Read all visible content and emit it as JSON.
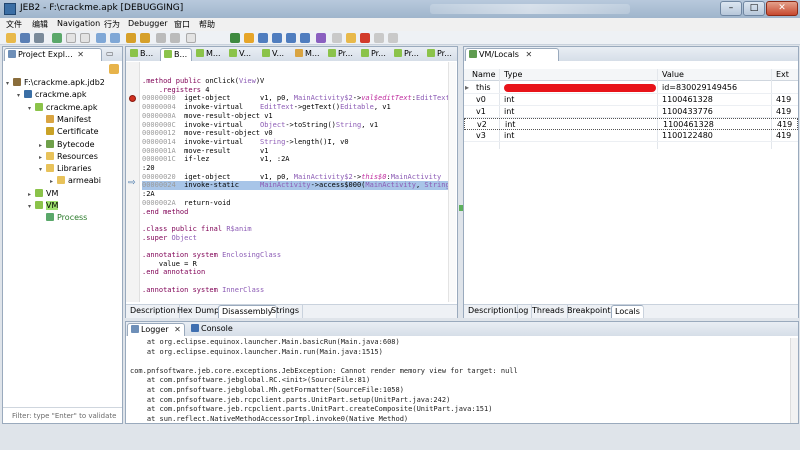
{
  "window": {
    "title": "JEB2 - F:\\crackme.apk [DEBUGGING]",
    "buttons": {
      "minimize": "–",
      "maximize": "□",
      "close": "✕"
    }
  },
  "menu": [
    "文件",
    "编辑",
    "Navigation",
    "行为",
    "Debugger",
    "窗口",
    "帮助"
  ],
  "toolbar_icons": [
    "open-icon",
    "save-icon",
    "settings-icon",
    "up-icon",
    "back-icon",
    "forward-icon",
    "run-icon",
    "debug-icon",
    "step-icon",
    "stop-icon",
    "pause-icon"
  ],
  "project_explorer": {
    "tab_label": "Project Expl...",
    "tree": [
      {
        "label": "F:\\crackme.apk.jdb2",
        "indent": 0,
        "arrow": "▾",
        "icon": "project"
      },
      {
        "label": "crackme.apk",
        "indent": 1,
        "arrow": "▾",
        "icon": "apk"
      },
      {
        "label": "crackme.apk",
        "indent": 2,
        "arrow": "▾",
        "icon": "android"
      },
      {
        "label": "Manifest",
        "indent": 3,
        "arrow": "",
        "icon": "manifest"
      },
      {
        "label": "Certificate",
        "indent": 3,
        "arrow": "",
        "icon": "certificate"
      },
      {
        "label": "Bytecode",
        "indent": 3,
        "arrow": "▸",
        "icon": "bytecode"
      },
      {
        "label": "Resources",
        "indent": 3,
        "arrow": "▸",
        "icon": "folder"
      },
      {
        "label": "Libraries",
        "indent": 3,
        "arrow": "▾",
        "icon": "folder"
      },
      {
        "label": "armeabi",
        "indent": 4,
        "arrow": "▸",
        "icon": "folder"
      },
      {
        "label": "VM",
        "indent": 2,
        "arrow": "▸",
        "icon": "android"
      },
      {
        "label": "VM",
        "indent": 2,
        "arrow": "▾",
        "icon": "android-highlight"
      },
      {
        "label": "Process",
        "indent": 3,
        "arrow": "",
        "icon": "process"
      }
    ],
    "filter_placeholder": "Filter: type \"Enter\" to validate"
  },
  "editor": {
    "tabs": [
      "B...",
      "B...",
      "M...",
      "V...",
      "V...",
      "M...",
      "Pr...",
      "Pr...",
      "Pr...",
      "Pr..."
    ],
    "bottom_tabs": [
      "Description",
      "Hex Dump",
      "Disassembly",
      "Strings"
    ],
    "active_bottom_tab": "Disassembly",
    "lines": [
      {
        "addr": "",
        "text": ".method public onClick(View)V",
        "kind": "header"
      },
      {
        "addr": "",
        "text": "    .registers 4",
        "kind": "directive"
      },
      {
        "addr": "00000000",
        "text": "iget-object       v1, p0, MainActivity$2->val$editText:EditText",
        "kind": "bp"
      },
      {
        "addr": "00000004",
        "text": "invoke-virtual    EditText->getText()Editable, v1",
        "kind": ""
      },
      {
        "addr": "0000000A",
        "text": "move-result-object v1",
        "kind": ""
      },
      {
        "addr": "0000000C",
        "text": "invoke-virtual    Object->toString()String, v1",
        "kind": ""
      },
      {
        "addr": "00000012",
        "text": "move-result-object v0",
        "kind": ""
      },
      {
        "addr": "00000014",
        "text": "invoke-virtual    String->length()I, v0",
        "kind": ""
      },
      {
        "addr": "0000001A",
        "text": "move-result       v1",
        "kind": ""
      },
      {
        "addr": "0000001C",
        "text": "if-lez            v1, :2A",
        "kind": ""
      },
      {
        "addr": "",
        "text": ":20",
        "kind": "label"
      },
      {
        "addr": "00000020",
        "text": "iget-object       v1, p0, MainActivity$2->this$0:MainActivity",
        "kind": ""
      },
      {
        "addr": "00000024",
        "text": "invoke-static     MainActivity->access$000(MainActivity, String)V",
        "kind": "current"
      },
      {
        "addr": "",
        "text": ":2A",
        "kind": "label"
      },
      {
        "addr": "0000002A",
        "text": "return-void",
        "kind": ""
      },
      {
        "addr": "",
        "text": ".end method",
        "kind": "header"
      },
      {
        "addr": "",
        "text": "",
        "kind": "blank"
      },
      {
        "addr": "",
        "text": ".class public final R$anim",
        "kind": "header"
      },
      {
        "addr": "",
        "text": ".super Object",
        "kind": "header"
      },
      {
        "addr": "",
        "text": "",
        "kind": "blank"
      },
      {
        "addr": "",
        "text": ".annotation system EnclosingClass",
        "kind": "header"
      },
      {
        "addr": "",
        "text": "    value = R",
        "kind": "directive"
      },
      {
        "addr": "",
        "text": ".end annotation",
        "kind": "header"
      },
      {
        "addr": "",
        "text": "",
        "kind": "blank"
      },
      {
        "addr": "",
        "text": ".annotation system InnerClass",
        "kind": "header"
      }
    ]
  },
  "vm_locals": {
    "tab_label": "VM/Locals",
    "columns": [
      "Name",
      "Type",
      "Value",
      "Ext"
    ],
    "rows": [
      {
        "name": "this",
        "type": "",
        "value": "id=830029149456",
        "ext": "",
        "redacted": true,
        "arrow": "▸"
      },
      {
        "name": "v0",
        "type": "int",
        "value": "1100461328",
        "ext": "419",
        "redacted": false,
        "arrow": ""
      },
      {
        "name": "v1",
        "type": "int",
        "value": "1100433776",
        "ext": "419",
        "redacted": false,
        "arrow": ""
      },
      {
        "name": "v2",
        "type": "int",
        "value": "1100461328",
        "ext": "419",
        "redacted": false,
        "arrow": ""
      },
      {
        "name": "v3",
        "type": "int",
        "value": "1100122480",
        "ext": "419",
        "redacted": false,
        "arrow": ""
      }
    ],
    "bottom_tabs": [
      "Description",
      "Log",
      "Threads",
      "Breakpoints",
      "Locals"
    ],
    "active_bottom_tab": "Locals"
  },
  "console": {
    "tabs": [
      "Logger",
      "Console"
    ],
    "lines": [
      "    at org.eclipse.equinox.launcher.Main.basicRun(Main.java:608)",
      "    at org.eclipse.equinox.launcher.Main.run(Main.java:1515)",
      "",
      "com.pnfsoftware.jeb.core.exceptions.JebException: Cannot render memory view for target: null",
      "    at com.pnfsoftware.jebglobal.RC.<init>(SourceFile:81)",
      "    at com.pnfsoftware.jebglobal.Mh.getFormatter(SourceFile:1058)",
      "    at com.pnfsoftware.jeb.rcpclient.parts.UnitPart.setup(UnitPart.java:242)",
      "    at com.pnfsoftware.jeb.rcpclient.parts.UnitPart.createComposite(UnitPart.java:151)",
      "    at sun.reflect.NativeMethodAccessorImpl.invoke0(Native Method)"
    ]
  },
  "colors": {
    "accent": "#3a6ea5",
    "highlight_row": "#a8c5e8",
    "breakpoint": "#d03020",
    "redaction": "#e8141a"
  }
}
